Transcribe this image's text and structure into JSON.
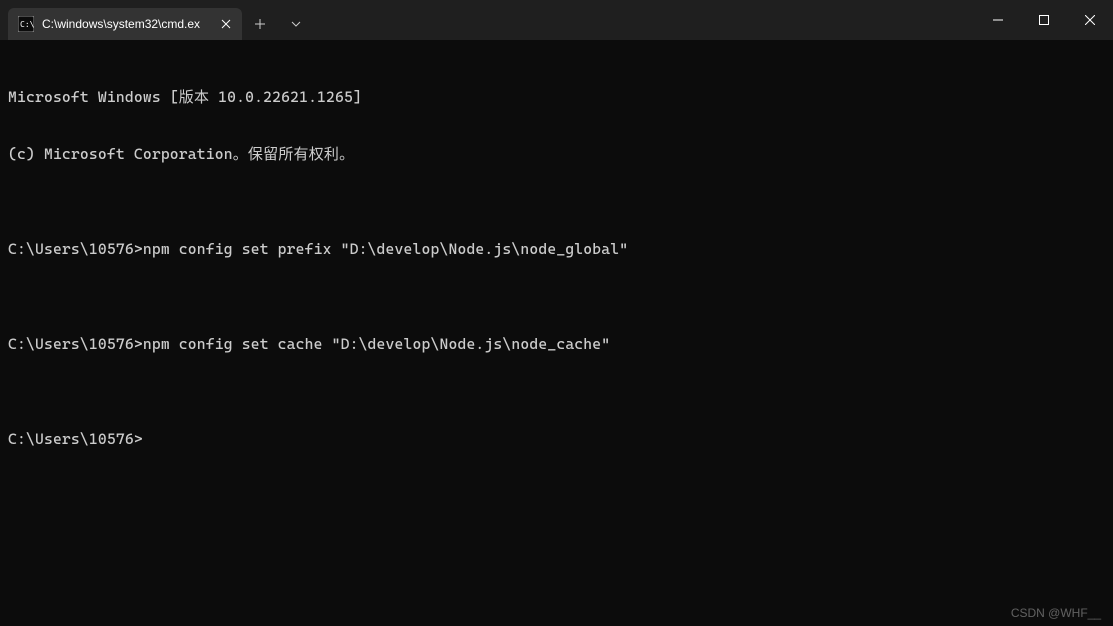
{
  "titlebar": {
    "tab": {
      "title": "C:\\windows\\system32\\cmd.ex",
      "icon_name": "cmd-icon"
    },
    "new_tab_tooltip": "New Tab",
    "dropdown_tooltip": "New Tab Dropdown"
  },
  "window_controls": {
    "minimize": "Minimize",
    "maximize": "Maximize",
    "close": "Close"
  },
  "terminal": {
    "lines": [
      "Microsoft Windows [版本 10.0.22621.1265]",
      "(c) Microsoft Corporation。保留所有权利。",
      "",
      "C:\\Users\\10576>npm config set prefix \"D:\\develop\\Node.js\\node_global\"",
      "",
      "C:\\Users\\10576>npm config set cache \"D:\\develop\\Node.js\\node_cache\"",
      "",
      "C:\\Users\\10576>"
    ]
  },
  "watermark": "CSDN @WHF__"
}
